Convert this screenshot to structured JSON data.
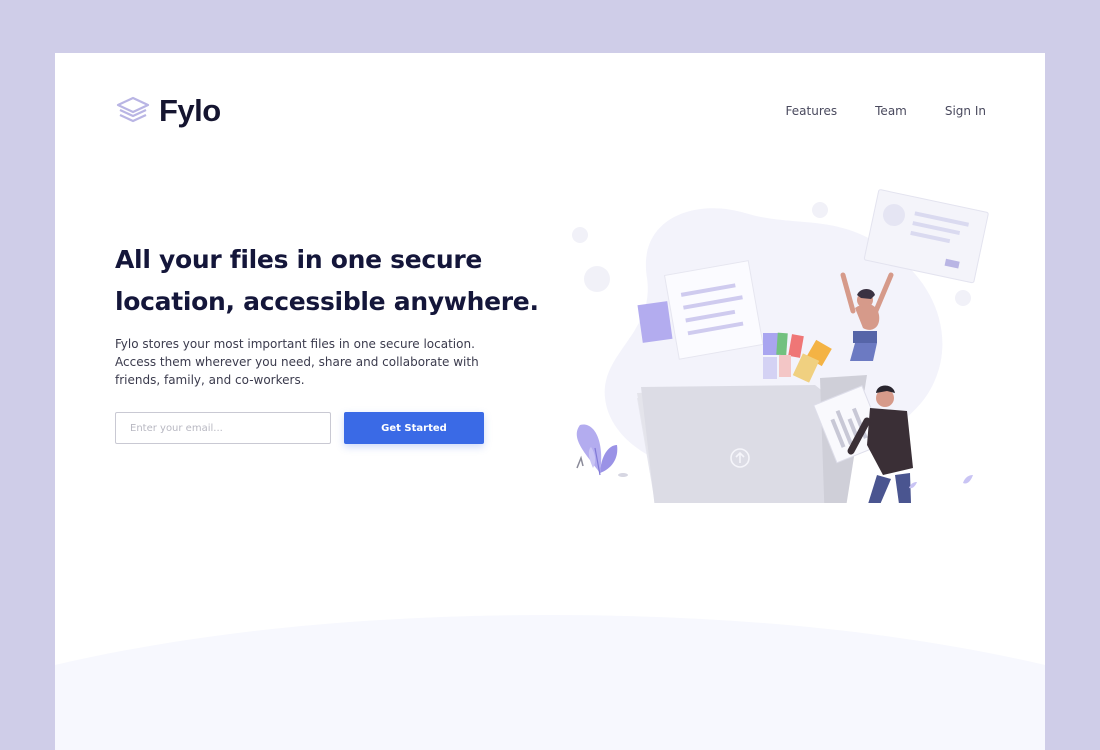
{
  "brand": {
    "name": "Fylo",
    "logo_icon": "stacked-layers-icon",
    "accent": "#3a6ae6",
    "logo_color": "#b9b5e4"
  },
  "nav": {
    "items": [
      "Features",
      "Team",
      "Sign In"
    ]
  },
  "hero": {
    "headline_line1": "All your files in one secure",
    "headline_line2": "location, accessible anywhere.",
    "description": "Fylo stores your most important files in one secure location. Access them wherever you need, share and collaborate with friends, family, and co-workers."
  },
  "signup": {
    "email_placeholder": "Enter your email...",
    "email_value": "",
    "button_label": "Get Started"
  },
  "colors": {
    "page_bg": "#cfcde8",
    "card_bg": "#ffffff",
    "wave_bg": "#f7f8fe",
    "headline": "#14163a"
  }
}
